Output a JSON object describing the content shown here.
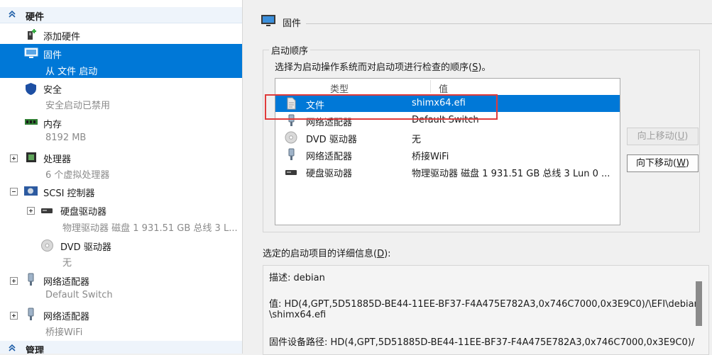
{
  "left": {
    "hardware_header": "硬件",
    "management_header": "管理",
    "items": [
      {
        "title": "添加硬件",
        "sub": ""
      },
      {
        "title": "固件",
        "sub": "从 文件 启动"
      },
      {
        "title": "安全",
        "sub": "安全启动已禁用"
      },
      {
        "title": "内存",
        "sub": "8192 MB"
      },
      {
        "title": "处理器",
        "sub": "6 个虚拟处理器"
      },
      {
        "title": "SCSI 控制器",
        "sub": ""
      },
      {
        "title": "硬盘驱动器",
        "sub": "物理驱动器 磁盘 1 931.51 GB 总线 3 L..."
      },
      {
        "title": "DVD 驱动器",
        "sub": "无"
      },
      {
        "title": "网络适配器",
        "sub": "Default Switch"
      },
      {
        "title": "网络适配器",
        "sub": "桥接WiFi"
      }
    ]
  },
  "right": {
    "header_title": "固件",
    "boot_order_title": "启动顺序",
    "instruction_prefix": "选择为启动操作系统而对启动项进行检查的顺序(",
    "instruction_key": "S",
    "instruction_suffix": ")。",
    "columns": {
      "type": "类型",
      "value": "值"
    },
    "boot_entries": [
      {
        "type": "文件",
        "value": "shimx64.efi",
        "selected": true
      },
      {
        "type": "网络适配器",
        "value": "Default Switch",
        "selected": false
      },
      {
        "type": "DVD 驱动器",
        "value": "无",
        "selected": false
      },
      {
        "type": "网络适配器",
        "value": "桥接WiFi",
        "selected": false
      },
      {
        "type": "硬盘驱动器",
        "value": "物理驱动器 磁盘 1 931.51 GB 总线 3 Lun 0 ...",
        "selected": false
      }
    ],
    "move_up": {
      "text": "向上移动(",
      "key": "U",
      "end": ")"
    },
    "move_down": {
      "text": "向下移动(",
      "key": "W",
      "end": ")"
    },
    "details_label_prefix": "选定的启动项目的详细信息(",
    "details_key": "D",
    "details_label_suffix": "):",
    "details": {
      "description": "描述: debian",
      "value_line1": "值: HD(4,GPT,5D51885D-BE44-11EE-BF37-F4A475E782A3,0x746C7000,0x3E9C0)/\\EFI\\debian",
      "value_line2": "\\shimx64.efi",
      "firmware_path": "固件设备路径: HD(4,GPT,5D51885D-BE44-11EE-BF37-F4A475E782A3,0x746C7000,0x3E9C0)/"
    }
  },
  "colors": {
    "selection": "#0078d7",
    "highlight_box": "#e03b3b"
  }
}
